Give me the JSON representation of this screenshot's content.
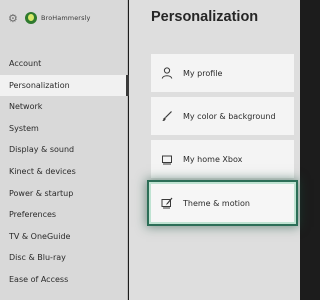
{
  "profile": {
    "gamertag": "BroHammersly",
    "settings_icon": "gear-icon"
  },
  "sidebar": {
    "items": [
      {
        "label": "Account"
      },
      {
        "label": "Personalization",
        "active": true
      },
      {
        "label": "Network"
      },
      {
        "label": "System"
      },
      {
        "label": "Display & sound"
      },
      {
        "label": "Kinect & devices"
      },
      {
        "label": "Power & startup"
      },
      {
        "label": "Preferences"
      },
      {
        "label": "TV & OneGuide"
      },
      {
        "label": "Disc & Blu-ray"
      },
      {
        "label": "Ease of Access"
      }
    ]
  },
  "main": {
    "title": "Personalization",
    "tiles": [
      {
        "label": "My profile",
        "icon": "person-icon"
      },
      {
        "label": "My color & background",
        "icon": "brush-icon"
      },
      {
        "label": "My home Xbox",
        "icon": "console-icon"
      },
      {
        "label": "Theme & motion",
        "icon": "theme-icon",
        "focused": true
      }
    ]
  },
  "colors": {
    "focus_ring": "#2c6e57",
    "sidebar_bg": "#d9d9d9",
    "main_bg": "#dedede",
    "tile_bg": "#f4f4f4"
  }
}
